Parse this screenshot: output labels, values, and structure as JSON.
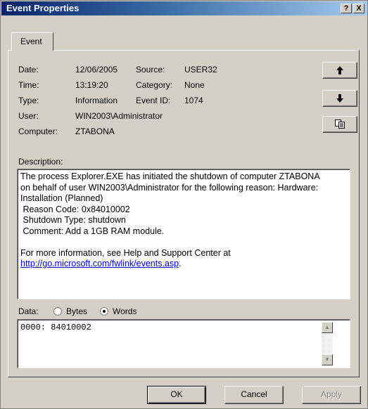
{
  "window": {
    "title": "Event Properties",
    "help_button": "?",
    "close_button": "X"
  },
  "tabs": [
    {
      "label": "Event"
    }
  ],
  "fields": {
    "date_label": "Date:",
    "date_value": "12/06/2005",
    "source_label": "Source:",
    "source_value": "USER32",
    "time_label": "Time:",
    "time_value": "13:19:20",
    "category_label": "Category:",
    "category_value": "None",
    "type_label": "Type:",
    "type_value": "Information",
    "event_id_label": "Event ID:",
    "event_id_value": "1074",
    "user_label": "User:",
    "user_value": "WIN2003\\Administrator",
    "computer_label": "Computer:",
    "computer_value": "ZTABONA"
  },
  "side_buttons": {
    "up_icon": "arrow-up-icon",
    "down_icon": "arrow-down-icon",
    "copy_icon": "copy-icon"
  },
  "description": {
    "label": "Description:",
    "text": "The process Explorer.EXE has initiated the shutdown of computer ZTABONA on behalf of user WIN2003\\Administrator for the following reason: Hardware: Installation (Planned)\n Reason Code: 0x84010002\n Shutdown Type: shutdown\n Comment: Add a 1GB RAM module.\n\nFor more information, see Help and Support Center at",
    "link": "http://go.microsoft.com/fwlink/events.asp",
    "link_suffix": "."
  },
  "data": {
    "label": "Data:",
    "bytes_label": "Bytes",
    "words_label": "Words",
    "selected": "Words",
    "content": "0000: 84010002"
  },
  "buttons": {
    "ok": "OK",
    "cancel": "Cancel",
    "apply": "Apply"
  },
  "colors": {
    "title_bar": "#0a246a",
    "dialog_face": "#d4d0c8",
    "link": "#0000ee"
  }
}
